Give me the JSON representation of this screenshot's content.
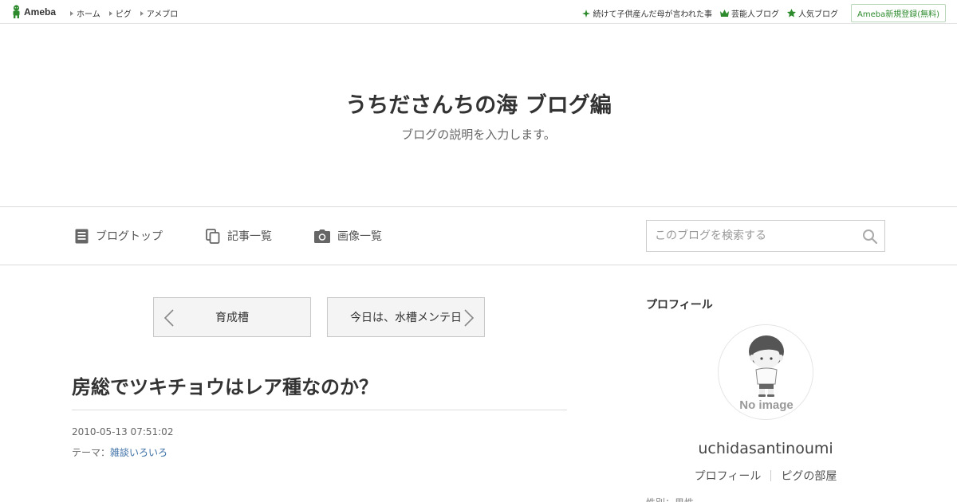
{
  "topbar": {
    "logo_text": "Ameba",
    "links": [
      "ホーム",
      "ピグ",
      "アメブロ"
    ],
    "right_links": [
      {
        "icon": "sparkle-icon",
        "label": "続けて子供産んだ母が言われた事"
      },
      {
        "icon": "crown-icon",
        "label": "芸能人ブログ"
      },
      {
        "icon": "star-icon",
        "label": "人気ブログ"
      }
    ],
    "register_label": "Ameba新規登録(無料)"
  },
  "header": {
    "title": "うちださんちの海 ブログ編",
    "description": "ブログの説明を入力します。"
  },
  "nav": {
    "items": [
      {
        "icon": "document-icon",
        "label": "ブログトップ"
      },
      {
        "icon": "copy-icon",
        "label": "記事一覧"
      },
      {
        "icon": "camera-icon",
        "label": "画像一覧"
      }
    ],
    "search_placeholder": "このブログを検索する"
  },
  "pager": {
    "prev_label": "育成槽",
    "next_label": "今日は、水槽メンテ日"
  },
  "entry": {
    "title": "房総でツキチョウはレア種なのか？",
    "date": "2010-05-13 07:51:02",
    "theme_prefix": "テーマ：",
    "theme_link": "雑談いろいろ"
  },
  "sidebar": {
    "heading": "プロフィール",
    "avatar_text": "No image",
    "username": "uchidasantinoumi",
    "profile_link": "プロフィール",
    "pig_link": "ピグの部屋",
    "cut_text": "性別：男性"
  },
  "colors": {
    "accent_green": "#2d8b2d",
    "link_blue": "#3b6ea5",
    "border": "#dcdcdc"
  }
}
